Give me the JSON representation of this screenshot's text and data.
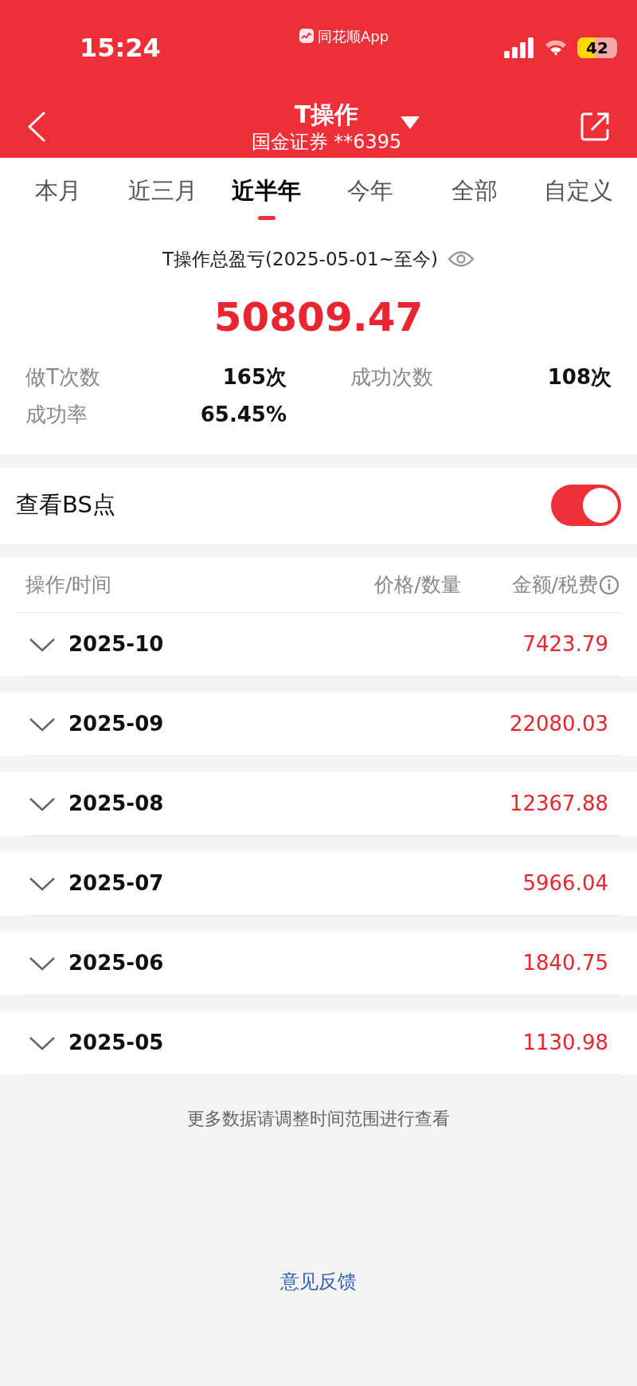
{
  "status_bar": {
    "time": "15:24",
    "app": "同花顺App",
    "battery": "42"
  },
  "header": {
    "title": "T操作",
    "subtitle": "国金证券 **6395"
  },
  "tabs": [
    {
      "label": "本月",
      "selected": false
    },
    {
      "label": "近三月",
      "selected": false
    },
    {
      "label": "近半年",
      "selected": true
    },
    {
      "label": "今年",
      "selected": false
    },
    {
      "label": "全部",
      "selected": false
    },
    {
      "label": "自定义",
      "selected": false
    }
  ],
  "summary": {
    "title": "T操作总盈亏(2025-05-01~至今)",
    "total": "50809.47",
    "stats": [
      {
        "label": "做T次数",
        "value": "165次"
      },
      {
        "label": "成功次数",
        "value": "108次"
      },
      {
        "label": "成功率",
        "value": "65.45%"
      }
    ]
  },
  "bs_toggle": {
    "label": "查看BS点",
    "on": true
  },
  "table": {
    "columns": [
      "操作/时间",
      "价格/数量",
      "金额/税费"
    ],
    "rows": [
      {
        "month": "2025-10",
        "amount": "7423.79",
        "expanded": false
      },
      {
        "month": "2025-09",
        "amount": "22080.03",
        "expanded": false
      },
      {
        "month": "2025-08",
        "amount": "12367.88",
        "expanded": false
      },
      {
        "month": "2025-07",
        "amount": "5966.04",
        "expanded": false
      },
      {
        "month": "2025-06",
        "amount": "1840.75",
        "expanded": false
      },
      {
        "month": "2025-05",
        "amount": "1130.98",
        "expanded": false
      }
    ]
  },
  "footer_note": "更多数据请调整时间范围进行查看",
  "feedback_link": "意见反馈"
}
